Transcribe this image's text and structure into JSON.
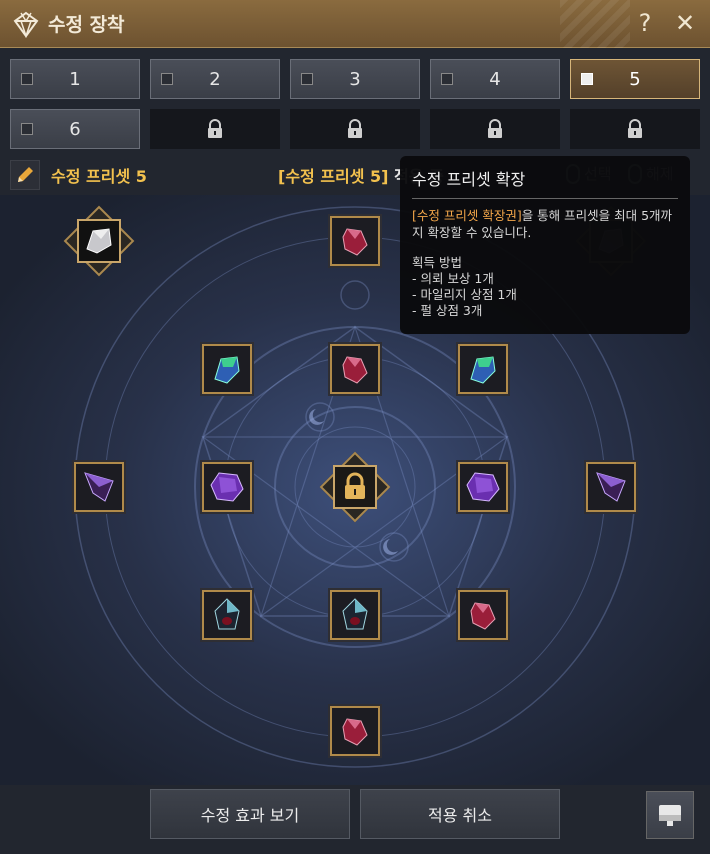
{
  "window": {
    "title": "수정 장착",
    "help_label": "?",
    "close_label": "✕",
    "title_icon": "gem-crown-icon"
  },
  "presets": {
    "slots": [
      {
        "label": "1",
        "active": false
      },
      {
        "label": "2",
        "active": false
      },
      {
        "label": "3",
        "active": false
      },
      {
        "label": "4",
        "active": false
      },
      {
        "label": "5",
        "active": true
      },
      {
        "label": "6",
        "active": false
      }
    ],
    "locked_count": 4,
    "current_name": "수정 프리셋 5",
    "applied_label": "[수정 프리셋 5]",
    "applied_suffix": " 적용 중",
    "select_hint": "선택",
    "release_hint": "해제"
  },
  "tooltip": {
    "title": "수정 프리셋 확장",
    "desc_highlight": "[수정 프리셋 확장권]",
    "desc_rest": "을 통해 프리셋을 최대 5개까지 확장할 수 있습니다.",
    "acquire_title": "획득 방법",
    "acquire_1": "- 의뢰 보상 1개",
    "acquire_2": "- 마일리지 상점 1개",
    "acquire_3": "- 펄 상점 3개"
  },
  "board": {
    "gems": [
      {
        "name": "gem-slot-top-left",
        "type": "silver"
      },
      {
        "name": "gem-slot-top-center",
        "type": "ruby"
      },
      {
        "name": "gem-slot-top-right",
        "type": "silver"
      },
      {
        "name": "gem-slot-upper-left",
        "type": "emerald"
      },
      {
        "name": "gem-slot-upper-center",
        "type": "ruby"
      },
      {
        "name": "gem-slot-upper-right",
        "type": "emerald"
      },
      {
        "name": "gem-slot-mid-far-left",
        "type": "amethyst-shard"
      },
      {
        "name": "gem-slot-mid-left",
        "type": "amethyst"
      },
      {
        "name": "gem-slot-center",
        "type": "locked"
      },
      {
        "name": "gem-slot-mid-right",
        "type": "amethyst"
      },
      {
        "name": "gem-slot-mid-far-right",
        "type": "amethyst-shard"
      },
      {
        "name": "gem-slot-lower-left",
        "type": "onyx"
      },
      {
        "name": "gem-slot-lower-center",
        "type": "onyx"
      },
      {
        "name": "gem-slot-lower-right",
        "type": "ruby"
      },
      {
        "name": "gem-slot-bottom",
        "type": "ruby"
      }
    ]
  },
  "actions": {
    "view_effects": "수정 효과 보기",
    "cancel_apply": "적용 취소",
    "extra_icon": "save-preset-icon"
  },
  "colors": {
    "accent_gold": "#f2c14e",
    "title_bar": "#8a6b3f",
    "highlight_orange": "#f2a64a"
  }
}
